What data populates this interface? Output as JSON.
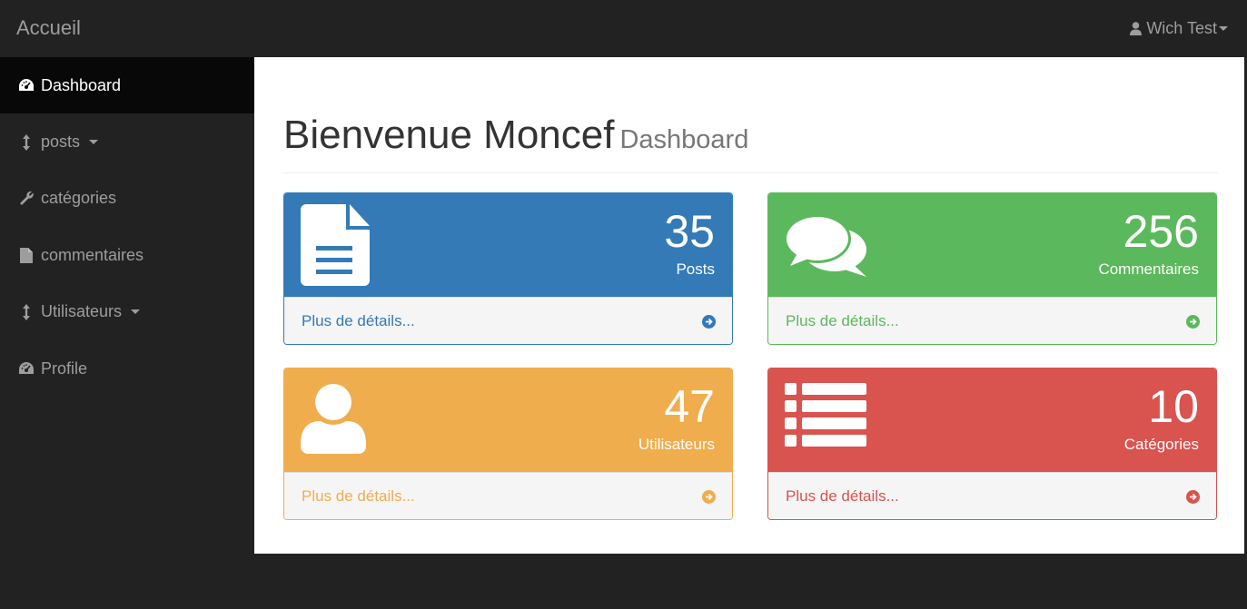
{
  "navbar": {
    "brand": "Accueil",
    "user": "Wich Test"
  },
  "sidebar": {
    "items": [
      {
        "label": "Dashboard",
        "icon": "dashboard-icon",
        "active": true
      },
      {
        "label": "posts",
        "icon": "resize-vertical-icon",
        "dropdown": true
      },
      {
        "label": "catégories",
        "icon": "wrench-icon"
      },
      {
        "label": "commentaires",
        "icon": "file-icon"
      },
      {
        "label": "Utilisateurs",
        "icon": "resize-vertical-icon",
        "dropdown": true
      },
      {
        "label": "Profile",
        "icon": "dashboard-icon"
      }
    ]
  },
  "header": {
    "title": "Bienvenue Moncef",
    "subtitle": "Dashboard"
  },
  "panels": [
    {
      "count": "35",
      "label": "Posts",
      "link": "Plus de détails...",
      "icon": "file-text-icon",
      "color": "#337ab7"
    },
    {
      "count": "256",
      "label": "Commentaires",
      "link": "Plus de détails...",
      "icon": "comments-icon",
      "color": "#5cb85c"
    },
    {
      "count": "47",
      "label": "Utilisateurs",
      "link": "Plus de détails...",
      "icon": "user-icon",
      "color": "#f0ad4e"
    },
    {
      "count": "10",
      "label": "Catégories",
      "link": "Plus de détails...",
      "icon": "list-icon",
      "color": "#d9534f"
    }
  ]
}
